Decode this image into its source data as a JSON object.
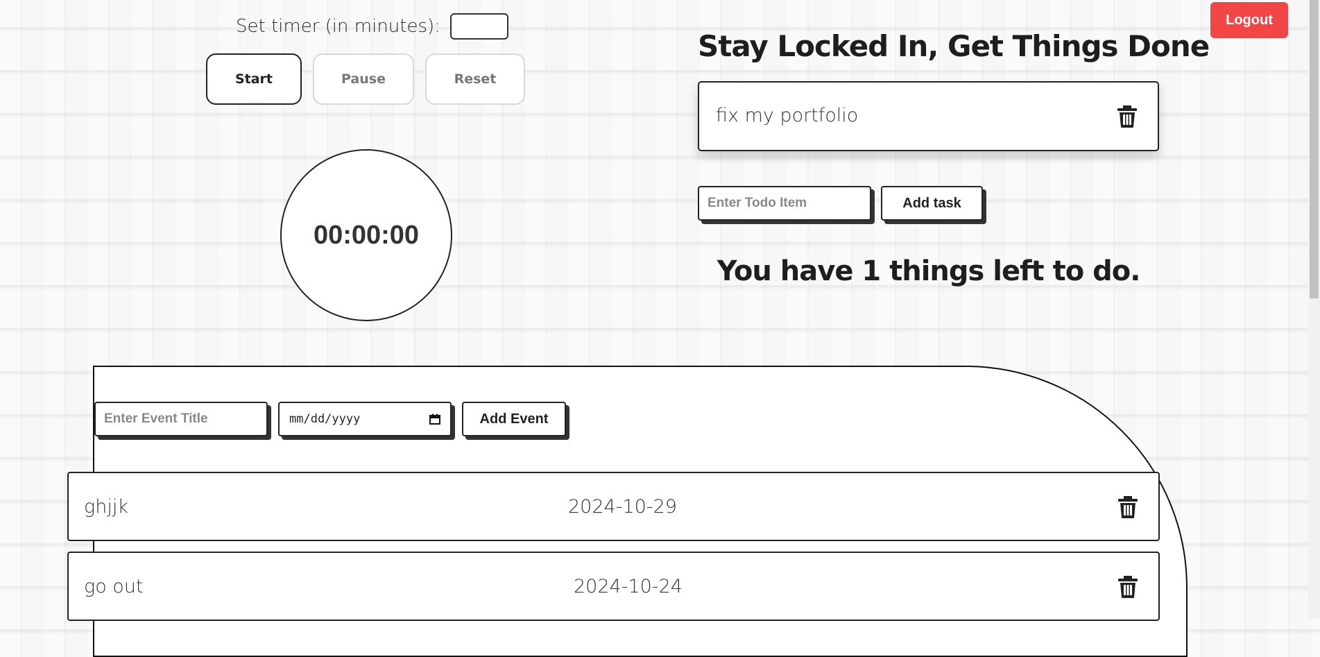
{
  "timer": {
    "label": "Set timer (in minutes):",
    "input_value": "",
    "start_label": "Start",
    "pause_label": "Pause",
    "reset_label": "Reset",
    "display": "00:00:00"
  },
  "header": {
    "logout_label": "Logout"
  },
  "todo": {
    "title": "Stay Locked In, Get Things Done",
    "items": [
      {
        "text": "fix my portfolio",
        "icon": "trash-icon"
      }
    ],
    "input_placeholder": "Enter Todo Item",
    "add_label": "Add task",
    "remaining_text": "You have 1 things left to do."
  },
  "events": {
    "title_placeholder": "Enter Event Title",
    "date_placeholder": "mm/dd/yyyy",
    "add_label": "Add Event",
    "items": [
      {
        "name": "ghjjk",
        "date": "2024-10-29",
        "icon": "trash-icon"
      },
      {
        "name": "go out",
        "date": "2024-10-24",
        "icon": "trash-icon"
      }
    ]
  },
  "colors": {
    "logout_bg": "#f24545",
    "text": "#222222",
    "muted_button_text": "#777777"
  }
}
